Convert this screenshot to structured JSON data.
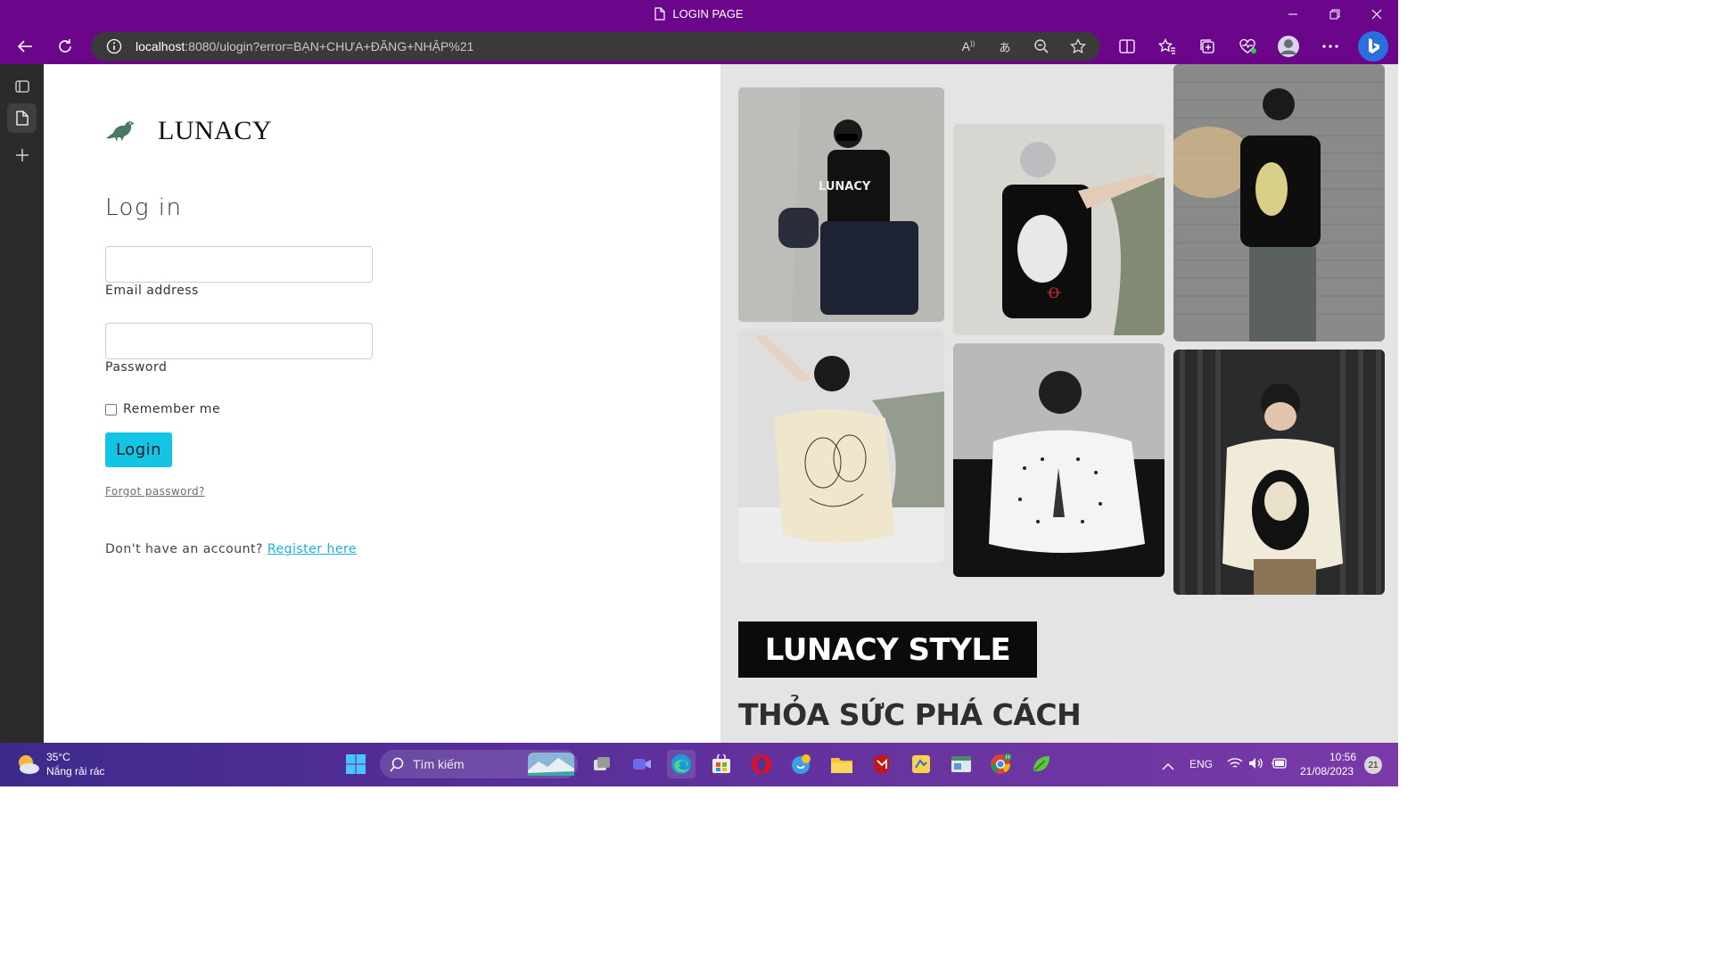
{
  "window": {
    "title": "LOGIN PAGE"
  },
  "browser": {
    "url_host": "localhost",
    "url_rest": ":8080/ulogin?error=BẠN+CHƯA+ĐĂNG+NHẬP%21"
  },
  "login": {
    "brand": "LUNACY",
    "heading": "Log in",
    "email_label": "Email address",
    "email_value": "",
    "password_label": "Password",
    "password_value": "",
    "remember_label": "Remember me",
    "login_button": "Login",
    "forgot_link": "Forgot password?",
    "no_account_text": "Don't have an account? ",
    "register_link": "Register here"
  },
  "promo": {
    "banner": "LUNACY STYLE",
    "subtitle": "THỎA SỨC PHÁ CÁCH",
    "shirt_text": "LUNACY"
  },
  "taskbar": {
    "temperature": "35°C",
    "weather": "Nắng rải rác",
    "search_placeholder": "Tìm kiếm",
    "language": "ENG",
    "time": "10:56",
    "date": "21/08/2023",
    "notifications": "21"
  },
  "colors": {
    "titlebar": "#6b068b",
    "accent": "#13c4e4",
    "link": "#13b4d8"
  }
}
